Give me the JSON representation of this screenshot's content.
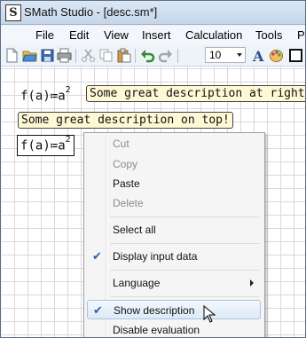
{
  "window": {
    "title": "SMath Studio - [desc.sm*]",
    "app_icon_letter": "S"
  },
  "menubar": {
    "items": [
      "File",
      "Edit",
      "View",
      "Insert",
      "Calculation",
      "Tools",
      "Pa"
    ]
  },
  "toolbar": {
    "font_size": "10"
  },
  "worksheet": {
    "formula1": {
      "lhs": "f",
      "arg": "a",
      "assign": "≔",
      "rhs": "a",
      "exp": "2"
    },
    "description_right": "Some great description at right!",
    "description_top": "Some great description on top!",
    "formula2": {
      "lhs": "f",
      "arg": "a",
      "assign": "≔",
      "rhs": "a",
      "exp": "2"
    }
  },
  "context_menu": {
    "cut": "Cut",
    "copy": "Copy",
    "paste": "Paste",
    "delete": "Delete",
    "select_all": "Select all",
    "display_input": "Display input data",
    "language": "Language",
    "show_description": "Show description",
    "disable_evaluation": "Disable evaluation",
    "checked": [
      "Display input data",
      "Show description"
    ],
    "disabled": [
      "Cut",
      "Copy",
      "Delete"
    ],
    "highlighted": "Show description"
  },
  "colors": {
    "description_bg": "#fff8d4",
    "check": "#2b5fa8",
    "highlight_border": "#a8c4e4"
  }
}
